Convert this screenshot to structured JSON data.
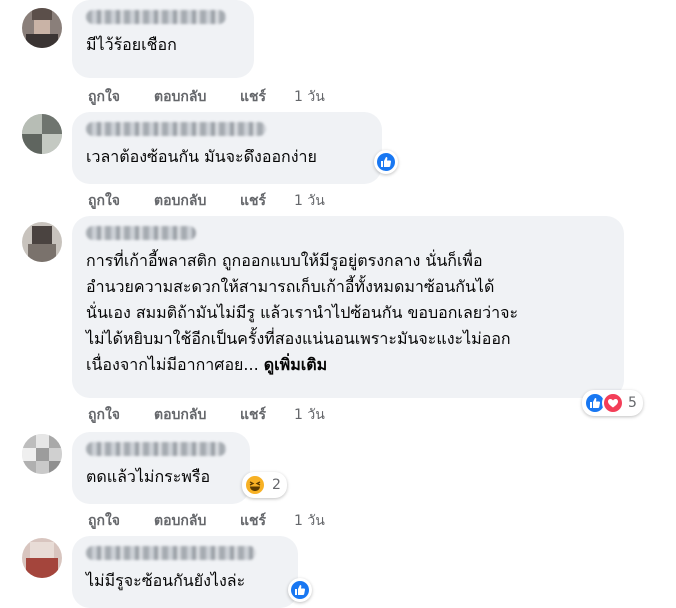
{
  "comments": [
    {
      "text": "มีไว้ร้อยเชือก",
      "actions": {
        "like": "ถูกใจ",
        "reply": "ตอบกลับ",
        "share": "แชร์",
        "time": "1 วัน"
      }
    },
    {
      "text": "เวลาต้องซ้อนกัน มันจะดึงออกง่าย",
      "reaction_icons": [
        "like-icon"
      ],
      "actions": {
        "like": "ถูกใจ",
        "reply": "ตอบกลับ",
        "share": "แชร์",
        "time": "1 วัน"
      }
    },
    {
      "text": "การที่เก้าอี้พลาสติก ถูกออกแบบให้มีรูอยู่ตรงกลาง นั่นก็เพื่อ\nอำนวยความสะดวกให้สามารถเก็บเก้าอี้ทั้งหมดมาซ้อนกันได้\nนั่นเอง สมมติถ้ามันไม่มีรู แล้วเรานำไปซ้อนกัน ขอบอกเลยว่าจะ\nไม่ได้หยิบมาใช้อีกเป็นครั้งที่สองแน่นอนเพราะมันจะแงะไม่ออก\nเนื่องจากไม่มีอากาศอย...",
      "see_more": "ดูเพิ่มเติม",
      "reaction_icons": [
        "like-icon",
        "love-icon"
      ],
      "reaction_count": "5",
      "actions": {
        "like": "ถูกใจ",
        "reply": "ตอบกลับ",
        "share": "แชร์",
        "time": "1 วัน"
      }
    },
    {
      "text": "ตดแล้วไม่กระพรือ",
      "reaction_icons": [
        "haha-icon"
      ],
      "reaction_count": "2",
      "actions": {
        "like": "ถูกใจ",
        "reply": "ตอบกลับ",
        "share": "แชร์",
        "time": "1 วัน"
      }
    },
    {
      "text": "ไม่มีรูจะซ้อนกันยังไงล่ะ",
      "reaction_icons": [
        "like-icon"
      ]
    }
  ],
  "colors": {
    "bubble": "#f0f2f5",
    "like": "#1877f2",
    "love": "#f33e58",
    "haha": "#f7b125",
    "meta": "#65676b"
  }
}
